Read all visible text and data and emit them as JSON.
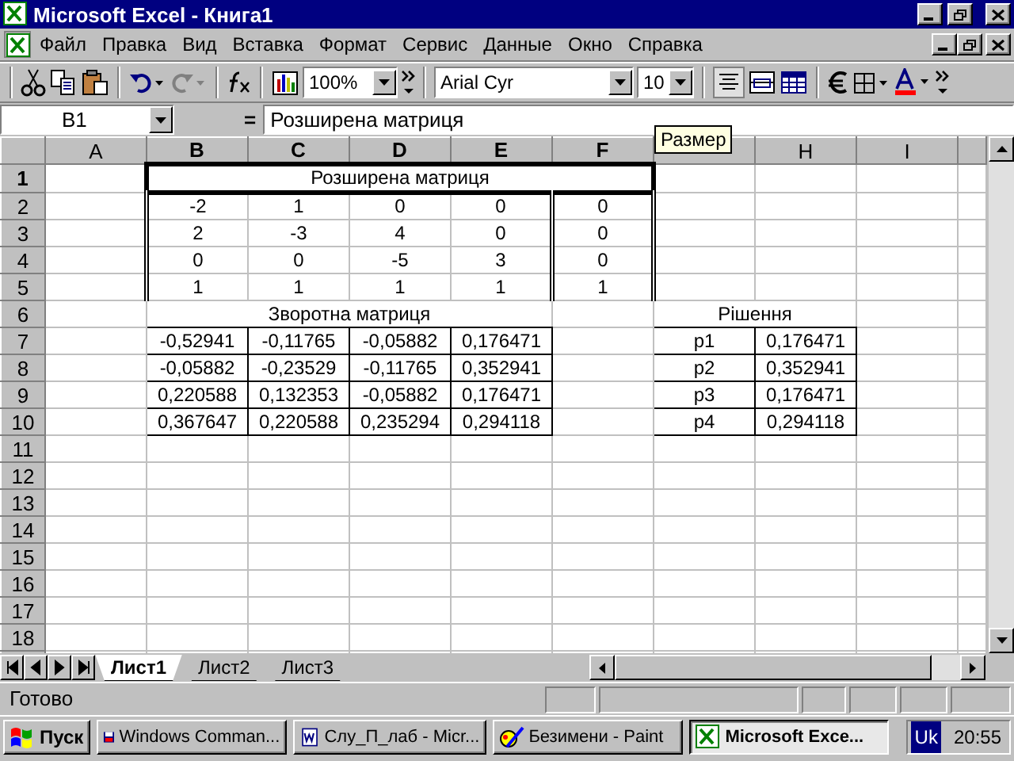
{
  "window": {
    "title": "Microsoft Excel - Книга1"
  },
  "menu": [
    "Файл",
    "Правка",
    "Вид",
    "Вставка",
    "Формат",
    "Сервис",
    "Данные",
    "Окно",
    "Справка"
  ],
  "toolbar": {
    "zoom": "100%",
    "font": "Arial Cyr",
    "font_size": "10",
    "redo_disabled": true
  },
  "formula_bar": {
    "name_box": "B1",
    "equals": "=",
    "value": "Розширена матриця"
  },
  "tooltip": "Размер",
  "columns": [
    {
      "label": "A",
      "selected": false
    },
    {
      "label": "B",
      "selected": true
    },
    {
      "label": "C",
      "selected": true
    },
    {
      "label": "D",
      "selected": true
    },
    {
      "label": "E",
      "selected": true
    },
    {
      "label": "F",
      "selected": true
    },
    null,
    {
      "label": "H",
      "selected": false
    },
    {
      "label": "I",
      "selected": false
    }
  ],
  "row_headers": [
    {
      "label": "1",
      "selected": true
    },
    {
      "label": "2",
      "selected": false
    },
    {
      "label": "3",
      "selected": false
    },
    {
      "label": "4",
      "selected": false
    },
    {
      "label": "5",
      "selected": false
    },
    {
      "label": "6",
      "selected": false
    },
    {
      "label": "7",
      "selected": false
    },
    {
      "label": "8",
      "selected": false
    },
    {
      "label": "9",
      "selected": false
    },
    {
      "label": "10",
      "selected": false
    },
    {
      "label": "11",
      "selected": false
    },
    {
      "label": "12",
      "selected": false
    },
    {
      "label": "13",
      "selected": false
    },
    {
      "label": "14",
      "selected": false
    },
    {
      "label": "15",
      "selected": false
    },
    {
      "label": "16",
      "selected": false
    },
    {
      "label": "17",
      "selected": false
    },
    {
      "label": "18",
      "selected": false
    }
  ],
  "sheet": {
    "title": {
      "text": "Розширена матриця",
      "selected": true
    },
    "matrix": [
      [
        "-2",
        "1",
        "0",
        "0",
        "0"
      ],
      [
        "2",
        "-3",
        "4",
        "0",
        "0"
      ],
      [
        "0",
        "0",
        "-5",
        "3",
        "0"
      ],
      [
        "1",
        "1",
        "1",
        "1",
        "1"
      ]
    ],
    "inverse": {
      "caption": "Зворотна матриця",
      "rows": [
        [
          "-0,52941",
          "-0,11765",
          "-0,05882",
          "0,176471"
        ],
        [
          "-0,05882",
          "-0,23529",
          "-0,11765",
          "0,352941"
        ],
        [
          "0,220588",
          "0,132353",
          "-0,05882",
          "0,176471"
        ],
        [
          "0,367647",
          "0,220588",
          "0,235294",
          "0,294118"
        ]
      ]
    },
    "solution": {
      "caption": "Рішення",
      "rows": [
        [
          "p1",
          "0,176471"
        ],
        [
          "p2",
          "0,352941"
        ],
        [
          "p3",
          "0,176471"
        ],
        [
          "p4",
          "0,294118"
        ]
      ]
    }
  },
  "sheet_tabs": [
    {
      "label": "Лист1",
      "selected": true
    },
    {
      "label": "Лист2",
      "selected": false
    },
    {
      "label": "Лист3",
      "selected": false
    }
  ],
  "status_bar": {
    "text": "Готово"
  },
  "taskbar": {
    "start": "Пуск",
    "tasks": [
      {
        "label": "Windows Comman...",
        "kind": "floppy",
        "selected": false
      },
      {
        "label": "Слу_П_лаб - Micr...",
        "kind": "word",
        "selected": false
      },
      {
        "label": "Безимени - Paint",
        "kind": "paint",
        "selected": false
      },
      {
        "label": "Microsoft Exce...",
        "kind": "excel",
        "selected": true
      }
    ],
    "language": "Uk",
    "clock": "20:55"
  }
}
